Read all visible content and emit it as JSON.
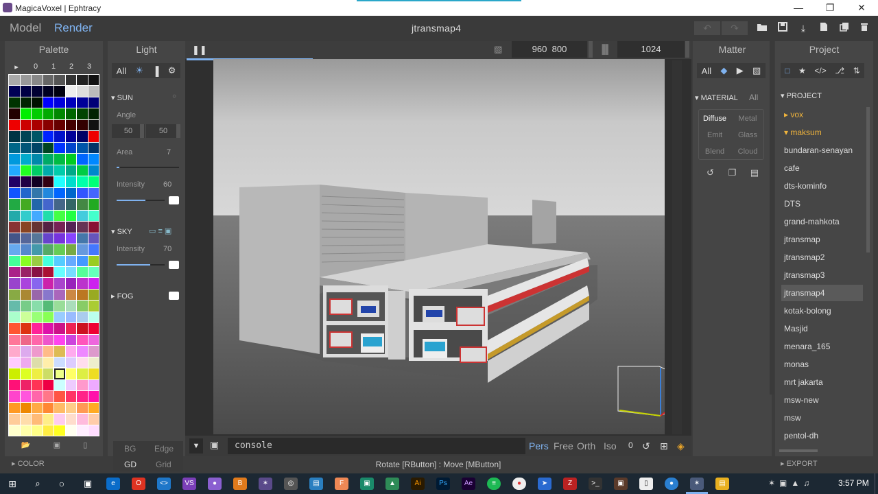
{
  "window": {
    "title": "MagicaVoxel | Ephtracy"
  },
  "app": {
    "modes": [
      "Model",
      "Render"
    ],
    "active_mode": "Render",
    "project_name": "jtransmap4"
  },
  "palette": {
    "title": "Palette",
    "tabs": [
      "▸",
      "0",
      "1",
      "2",
      "3"
    ],
    "colors": [
      "#aaaaaa",
      "#999999",
      "#888888",
      "#666666",
      "#555555",
      "#333333",
      "#222222",
      "#111111",
      "#000055",
      "#000044",
      "#000033",
      "#000022",
      "#000011",
      "#eeeeee",
      "#dddddd",
      "#bbbbbb",
      "#003300",
      "#002200",
      "#001100",
      "#0000ff",
      "#0000dd",
      "#0000bb",
      "#000099",
      "#000077",
      "#220000",
      "#00ee00",
      "#00cc00",
      "#00aa00",
      "#008800",
      "#006600",
      "#004400",
      "#002200",
      "#ee0000",
      "#cc0000",
      "#aa0000",
      "#880000",
      "#660000",
      "#440000",
      "#330000",
      "#111111",
      "#003344",
      "#004455",
      "#005566",
      "#0022ff",
      "#0011cc",
      "#000099",
      "#000066",
      "#ee0000",
      "#006688",
      "#005577",
      "#004466",
      "#004422",
      "#0033ff",
      "#0044cc",
      "#0055aa",
      "#003366",
      "#0099dd",
      "#00aacc",
      "#0088aa",
      "#00aa66",
      "#00bb44",
      "#00cc22",
      "#0066ff",
      "#0088ff",
      "#22aaff",
      "#22ff22",
      "#00cc66",
      "#00aaaa",
      "#00ccaa",
      "#00aa88",
      "#00cc44",
      "#0088cc",
      "#220066",
      "#220044",
      "#110022",
      "#330011",
      "#22ffff",
      "#00ddcc",
      "#00ffaa",
      "#00ff77",
      "#1155ff",
      "#2266cc",
      "#3377aa",
      "#2288dd",
      "#0066ff",
      "#0066cc",
      "#3355ff",
      "#4466ff",
      "#22aa44",
      "#44aa22",
      "#2266aa",
      "#4466cc",
      "#446688",
      "#336666",
      "#448844",
      "#22aa22",
      "#22aaaa",
      "#33cccc",
      "#44aaff",
      "#22ddaa",
      "#44ff44",
      "#22ff44",
      "#44ccdd",
      "#44ffcc",
      "#883333",
      "#884422",
      "#663333",
      "#552244",
      "#772255",
      "#552255",
      "#663355",
      "#881133",
      "#445588",
      "#556699",
      "#557799",
      "#6644cc",
      "#7733dd",
      "#8844ff",
      "#4477aa",
      "#6655bb",
      "#66aaee",
      "#5588cc",
      "#4499aa",
      "#55aa66",
      "#66cc55",
      "#77aa44",
      "#6699dd",
      "#4477ff",
      "#44ff99",
      "#88ff22",
      "#99cc44",
      "#44ffdd",
      "#55ccff",
      "#66aaff",
      "#4499ff",
      "#99cc22",
      "#aa2288",
      "#992266",
      "#881144",
      "#aa1133",
      "#66ffff",
      "#77ddff",
      "#55ff99",
      "#66ffbb",
      "#9944cc",
      "#aa44dd",
      "#8866ee",
      "#cc22aa",
      "#aa44cc",
      "#9922bb",
      "#bb33cc",
      "#cc22ee",
      "#88aa44",
      "#aa8833",
      "#9966aa",
      "#8877cc",
      "#aa66bb",
      "#cc8844",
      "#bb7722",
      "#99aa22",
      "#66bbaa",
      "#77cc88",
      "#88ddaa",
      "#55bb77",
      "#99dd99",
      "#aaddbb",
      "#88cc66",
      "#aacc33",
      "#aaffcc",
      "#ccff99",
      "#99ff77",
      "#88ff55",
      "#99ccff",
      "#99bbff",
      "#aaccee",
      "#bbffee",
      "#ff5533",
      "#dd3311",
      "#ff2299",
      "#dd11aa",
      "#cc1188",
      "#ee2255",
      "#cc1122",
      "#ee0033",
      "#ff7799",
      "#ee6688",
      "#ff66aa",
      "#ee55cc",
      "#ff44ee",
      "#cc44dd",
      "#ff55bb",
      "#ee66dd",
      "#ffaacc",
      "#ddaaee",
      "#ee99cc",
      "#ffbb88",
      "#ddbb55",
      "#ffaaee",
      "#ee88ff",
      "#dd99cc",
      "#ffccff",
      "#eeaaee",
      "#ddddaa",
      "#ffeeaa",
      "#ccddff",
      "#ddccff",
      "#ffddee",
      "#eeeecc",
      "#ccee00",
      "#ddff22",
      "#eeee44",
      "#ccdd66",
      "#eeff88",
      "#ffff66",
      "#ddee44",
      "#eedd22",
      "#ff1177",
      "#ee2266",
      "#ff3355",
      "#ee0044",
      "#ccffff",
      "#eeccff",
      "#ff99cc",
      "#eeaaff",
      "#ff44cc",
      "#ff55dd",
      "#ff66aa",
      "#ff7788",
      "#ff5544",
      "#ff3366",
      "#ff2288",
      "#ff11aa",
      "#ff9922",
      "#ee8800",
      "#ffaa44",
      "#ff8833",
      "#ffbb66",
      "#ffcc88",
      "#ff9955",
      "#ffaa22",
      "#ffcc99",
      "#ffddaa",
      "#ffbb77",
      "#ffee88",
      "#ffccee",
      "#ffddcc",
      "#ffbbdd",
      "#ffccaa",
      "#ffffcc",
      "#ffffaa",
      "#ffff88",
      "#ffee44",
      "#ffff22",
      "#fffff0",
      "#ffeeff",
      "#ffddff"
    ],
    "selected_index": 212,
    "footer_label": "COLOR"
  },
  "light": {
    "title": "Light",
    "tabs": [
      "All"
    ],
    "sun": {
      "label": "SUN",
      "angle_label": "Angle",
      "angle_a": "50",
      "angle_b": "50",
      "area_label": "Area",
      "area": "7",
      "area_level": 0.04,
      "intensity_label": "Intensity",
      "intensity": "60",
      "intensity_level": 0.6
    },
    "sky": {
      "label": "SKY",
      "intensity_label": "Intensity",
      "intensity": "70",
      "intensity_level": 0.7
    },
    "fog": {
      "label": "FOG"
    },
    "bottom": {
      "bg": "BG",
      "edge": "Edge",
      "gd": "GD",
      "grid": "Grid"
    }
  },
  "viewport": {
    "width": "960",
    "height": "800",
    "samples": "1024",
    "progress": 0.22,
    "console_text": "console",
    "cameras": [
      "Pers",
      "Free",
      "Orth",
      "Iso"
    ],
    "active_camera": "Pers",
    "iso_value": "0",
    "status": "Rotate [RButton] : Move [MButton]"
  },
  "matter": {
    "title": "Matter",
    "tab_all": "All",
    "material_label": "MATERIAL",
    "material_all": "All",
    "types": [
      "Diffuse",
      "Metal",
      "Emit",
      "Glass",
      "Blend",
      "Cloud"
    ],
    "active_type": "Diffuse"
  },
  "project": {
    "title": "Project",
    "section": "PROJECT",
    "items": [
      "vox",
      "maksum",
      "bundaran-senayan",
      "cafe",
      "dts-kominfo",
      "DTS",
      "grand-mahkota",
      "jtransmap",
      "jtransmap2",
      "jtransmap3",
      "jtransmap4",
      "kotak-bolong",
      "Masjid",
      "menara_165",
      "monas",
      "mrt jakarta",
      "msw-new",
      "msw",
      "pentol-dh"
    ],
    "folders": [
      "vox",
      "maksum"
    ],
    "selected": "jtransmap4",
    "export_label": "EXPORT"
  },
  "taskbar": {
    "time": "3:57 PM"
  }
}
